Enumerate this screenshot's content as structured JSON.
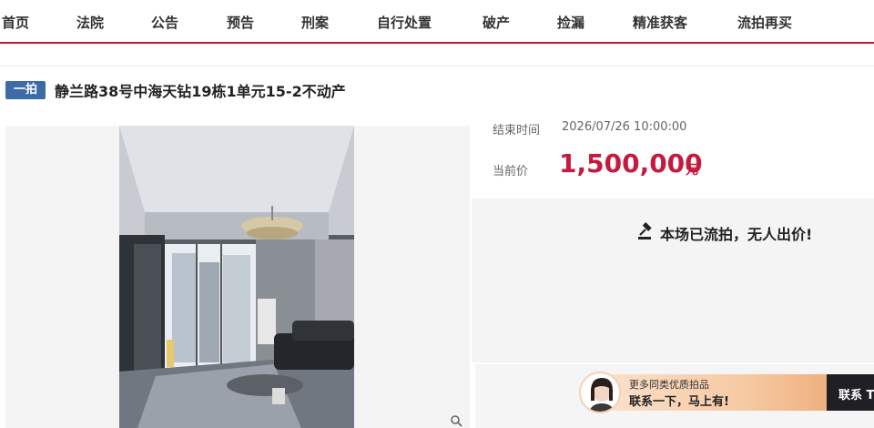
{
  "nav": {
    "items": [
      {
        "label": "首页"
      },
      {
        "label": "法院"
      },
      {
        "label": "公告"
      },
      {
        "label": "预告"
      },
      {
        "label": "刑案"
      },
      {
        "label": "自行处置"
      },
      {
        "label": "破产"
      },
      {
        "label": "捡漏"
      },
      {
        "label": "精准获客"
      },
      {
        "label": "流拍再买"
      }
    ],
    "accent_color": "#c6193d"
  },
  "listing": {
    "tag": "一拍",
    "tag_color": "#3d6aa8",
    "title": "静兰路38号中海天钻19栋1单元15-2不动产"
  },
  "info": {
    "end_time_label": "结束时间",
    "end_time_value": "2026/07/26 10:00:00",
    "price_label": "当前价",
    "price_value": "1,500,000",
    "price_unit": "元",
    "status": "本场已流拍，无人出价!"
  },
  "contact": {
    "line1": "更多同类优质拍品",
    "line2": "联系一下，马上有!",
    "button": "联系 T"
  },
  "icons": {
    "gavel": "gavel-icon",
    "magnify": "magnifier-icon"
  }
}
